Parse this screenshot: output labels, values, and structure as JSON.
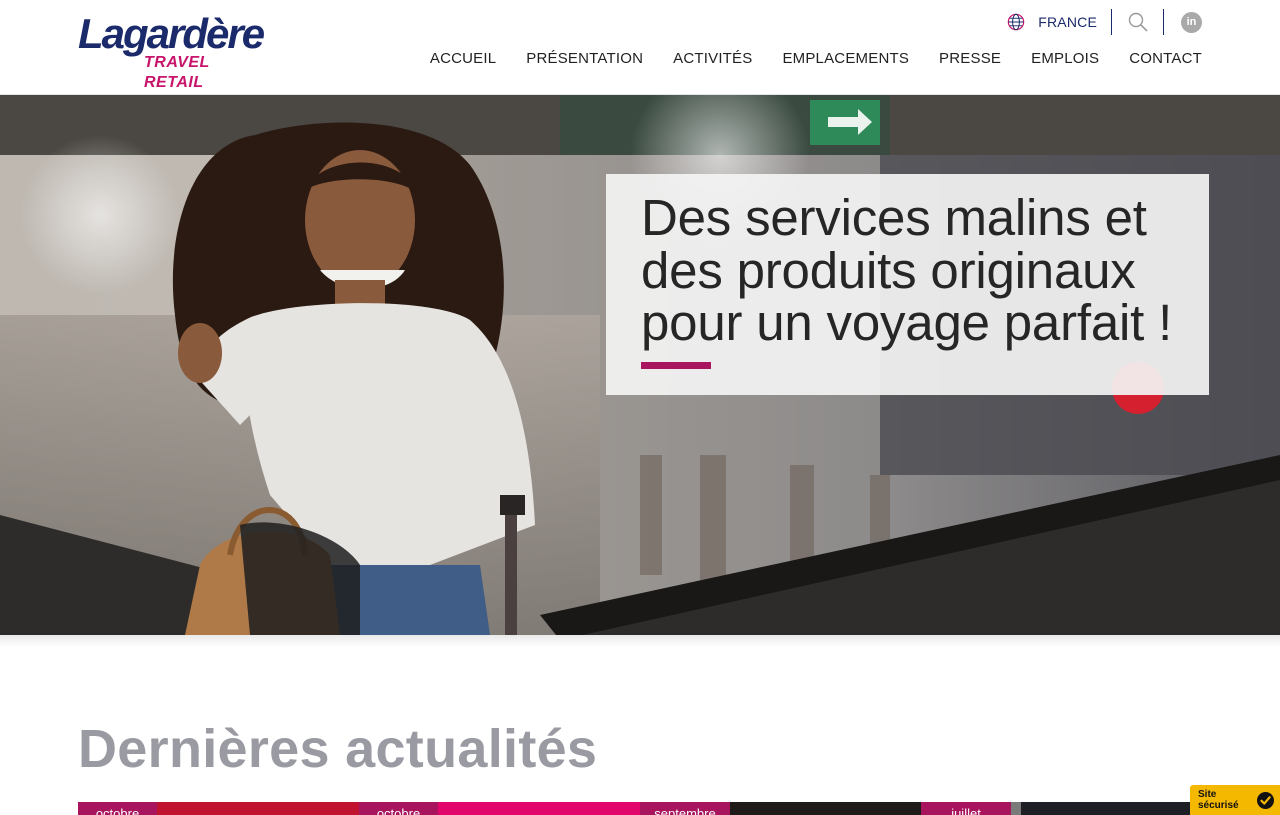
{
  "brand": {
    "name": "Lagardère",
    "tagline": "TRAVEL RETAIL",
    "primary_color": "#1b2a6b",
    "accent_color": "#c8156b"
  },
  "topbar": {
    "country_label": "FRANCE",
    "search_icon": "search-icon",
    "linkedin_label": "in"
  },
  "nav": {
    "items": [
      "ACCUEIL",
      "PRÉSENTATION",
      "ACTIVITÉS",
      "EMPLACEMENTS",
      "PRESSE",
      "EMPLOIS",
      "CONTACT"
    ]
  },
  "hero": {
    "headline": "Des services malins et des produits originaux pour un voyage parfait !",
    "accent_color": "#a8155e"
  },
  "news": {
    "title": "Dernières actualités",
    "cards": [
      {
        "date_label": "octobre"
      },
      {
        "date_label": "octobre"
      },
      {
        "date_label": "septembre"
      },
      {
        "date_label": "juillet"
      }
    ]
  },
  "badge": {
    "line1": "Site",
    "line2": "sécurisé",
    "color": "#f5b800"
  }
}
